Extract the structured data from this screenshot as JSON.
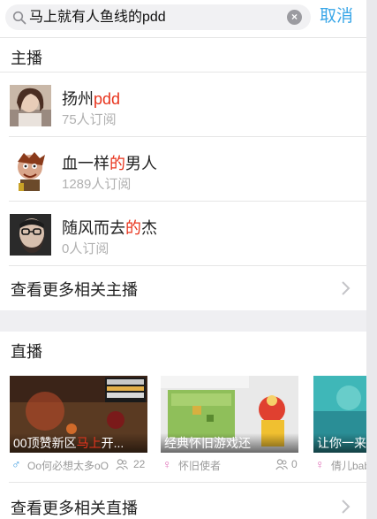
{
  "search": {
    "query": "马上就有人鱼线的pdd",
    "cancel_label": "取消"
  },
  "anchors_section": {
    "title": "主播",
    "items": [
      {
        "name_plain": "扬州",
        "name_highlight": "pdd",
        "name_tail": "",
        "subscribers": "75人订阅"
      },
      {
        "name_plain": "血一样",
        "name_highlight": "的",
        "name_tail": "男人",
        "subscribers": "1289人订阅"
      },
      {
        "name_plain": "随风而去",
        "name_highlight": "的",
        "name_tail": "杰",
        "subscribers": "0人订阅"
      }
    ],
    "more_label": "查看更多相关主播"
  },
  "live_section": {
    "title": "直播",
    "cards": [
      {
        "title": "00顶赞新区",
        "title_highlight": "马上",
        "title_tail": "开...",
        "streamer": "Oo何必想太多oO",
        "viewers": "22",
        "gender": "male"
      },
      {
        "title": "经典怀旧游戏还",
        "title_highlight": "",
        "title_tail": "",
        "streamer": "怀旧使者",
        "viewers": "0",
        "gender": "female"
      },
      {
        "title": "让你一来",
        "title_highlight": "",
        "title_tail": "",
        "streamer": "倩儿bab",
        "viewers": "",
        "gender": "female"
      }
    ],
    "more_label": "查看更多相关直播"
  },
  "colors": {
    "accent": "#3aa7e8",
    "highlight": "#e8341d",
    "male": "#3b9be0",
    "female": "#e070b8"
  }
}
